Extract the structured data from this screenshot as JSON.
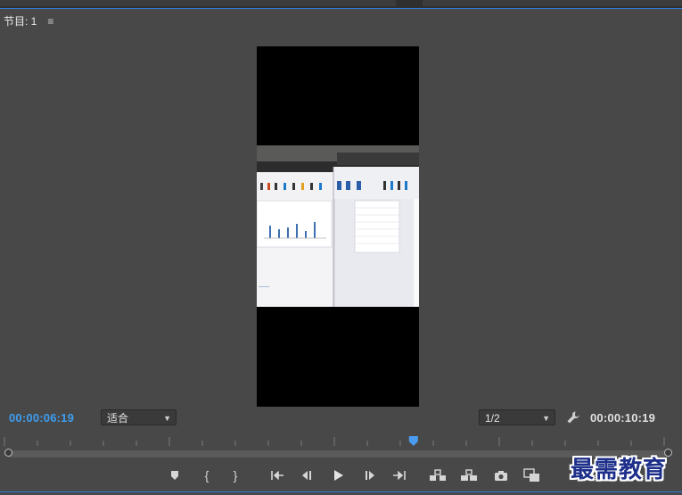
{
  "panel": {
    "tab_label": "节目: 1",
    "menu_icon": "≡"
  },
  "video": {
    "description_icon": "video-frame"
  },
  "timecode": {
    "current": "00:00:06:19",
    "duration": "00:00:10:19"
  },
  "fit_select": {
    "value": "适合",
    "icon": "chevron-down-icon"
  },
  "resolution_select": {
    "value": "1/2",
    "icon": "chevron-down-icon"
  },
  "settings": {
    "icon": "wrench-icon"
  },
  "playhead": {
    "position_fraction": 0.62
  },
  "controls": {
    "buttons": [
      {
        "name": "add-marker-button",
        "icon": "marker-icon"
      },
      {
        "name": "mark-in-button",
        "icon": "brace-left-icon",
        "glyph": "{"
      },
      {
        "name": "mark-out-button",
        "icon": "brace-right-icon",
        "glyph": "}"
      },
      {
        "name": "go-to-in-button",
        "icon": "go-to-in-icon"
      },
      {
        "name": "step-back-button",
        "icon": "step-back-icon"
      },
      {
        "name": "play-button",
        "icon": "play-icon"
      },
      {
        "name": "step-forward-button",
        "icon": "step-forward-icon"
      },
      {
        "name": "go-to-out-button",
        "icon": "go-to-out-icon"
      },
      {
        "name": "lift-button",
        "icon": "lift-icon"
      },
      {
        "name": "extract-button",
        "icon": "extract-icon"
      },
      {
        "name": "export-frame-button",
        "icon": "camera-icon"
      },
      {
        "name": "comparison-view-button",
        "icon": "comparison-icon"
      }
    ]
  },
  "watermark": {
    "text": "最需教育"
  },
  "colors": {
    "accent": "#2f7ad8",
    "timecode_current": "#3e9ef2",
    "panel_bg": "#484848"
  }
}
